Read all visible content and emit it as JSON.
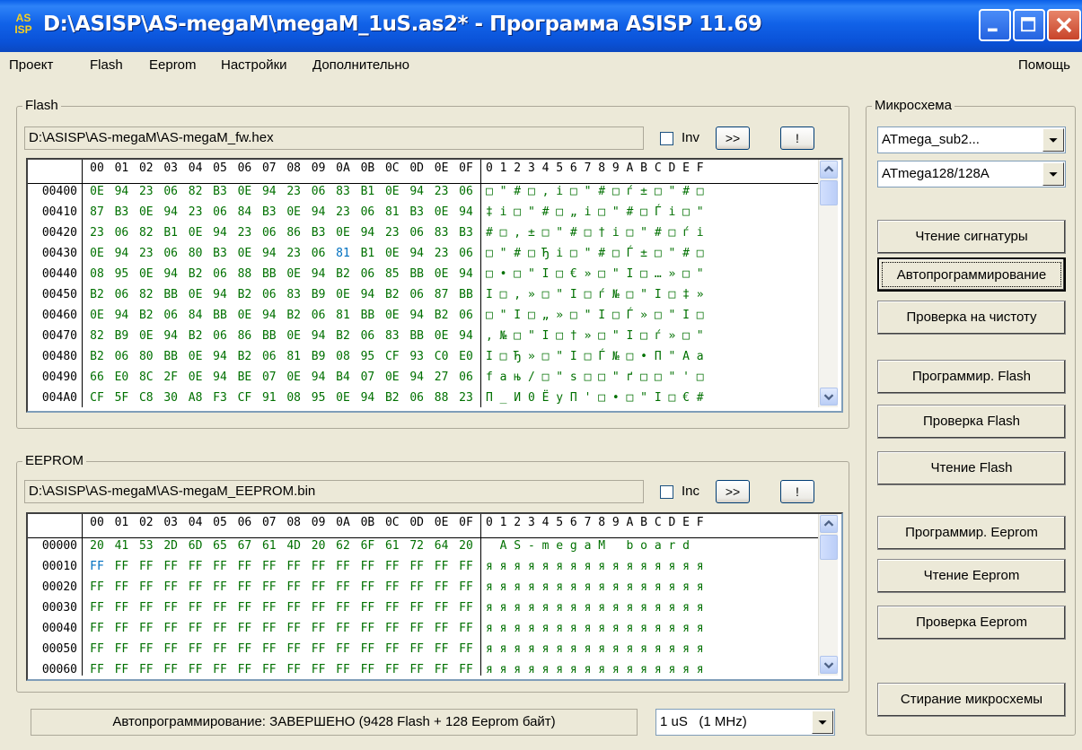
{
  "window": {
    "title": "D:\\ASISP\\AS-megaM\\megaM_1uS.as2* - Программа ASISP 11.69",
    "icon_top": "AS",
    "icon_bottom": "ISP"
  },
  "menu": {
    "items": [
      "Проект",
      "Flash",
      "Eeprom",
      "Настройки",
      "Дополнительно"
    ],
    "help": "Помощь"
  },
  "flash": {
    "title": "Flash",
    "path": "D:\\ASISP\\AS-megaM\\AS-megaM_fw.hex",
    "checkbox_label": "Inv",
    "btn_next": ">>",
    "btn_excl": "!",
    "header": [
      "00",
      "01",
      "02",
      "03",
      "04",
      "05",
      "06",
      "07",
      "08",
      "09",
      "0A",
      "0B",
      "0C",
      "0D",
      "0E",
      "0F"
    ],
    "ascii_header": "0 1 2 3 4 5 6 7 8 9 A B C D E F",
    "rows": [
      {
        "addr": "00400",
        "bytes": [
          "0E",
          "94",
          "23",
          "06",
          "82",
          "B3",
          "0E",
          "94",
          "23",
          "06",
          "83",
          "B1",
          "0E",
          "94",
          "23",
          "06"
        ],
        "ascii": "□ \" # □ , i □ \" # □ ѓ ± □ \" # □"
      },
      {
        "addr": "00410",
        "bytes": [
          "87",
          "B3",
          "0E",
          "94",
          "23",
          "06",
          "84",
          "B3",
          "0E",
          "94",
          "23",
          "06",
          "81",
          "B3",
          "0E",
          "94"
        ],
        "ascii": "‡ i □ \" # □ „ i □ \" # □ Ѓ i □ \""
      },
      {
        "addr": "00420",
        "bytes": [
          "23",
          "06",
          "82",
          "B1",
          "0E",
          "94",
          "23",
          "06",
          "86",
          "B3",
          "0E",
          "94",
          "23",
          "06",
          "83",
          "B3"
        ],
        "ascii": "# □ , ± □ \" # □ † i □ \" # □ ѓ i"
      },
      {
        "addr": "00430",
        "bytes": [
          "0E",
          "94",
          "23",
          "06",
          "80",
          "B3",
          "0E",
          "94",
          "23",
          "06",
          "81",
          "B1",
          "0E",
          "94",
          "23",
          "06"
        ],
        "ascii": "□ \" # □ Ђ i □ \" # □ Ѓ ± □ \" # □"
      },
      {
        "addr": "00440",
        "bytes": [
          "08",
          "95",
          "0E",
          "94",
          "B2",
          "06",
          "88",
          "BB",
          "0E",
          "94",
          "B2",
          "06",
          "85",
          "BB",
          "0E",
          "94"
        ],
        "ascii": "□ • □ \" I □ € » □ \" I □ … » □ \""
      },
      {
        "addr": "00450",
        "bytes": [
          "B2",
          "06",
          "82",
          "BB",
          "0E",
          "94",
          "B2",
          "06",
          "83",
          "B9",
          "0E",
          "94",
          "B2",
          "06",
          "87",
          "BB"
        ],
        "ascii": "I □ , » □ \" I □ ѓ № □ \" I □ ‡ »"
      },
      {
        "addr": "00460",
        "bytes": [
          "0E",
          "94",
          "B2",
          "06",
          "84",
          "BB",
          "0E",
          "94",
          "B2",
          "06",
          "81",
          "BB",
          "0E",
          "94",
          "B2",
          "06"
        ],
        "ascii": "□ \" I □ „ » □ \" I □ Ѓ » □ \" I □"
      },
      {
        "addr": "00470",
        "bytes": [
          "82",
          "B9",
          "0E",
          "94",
          "B2",
          "06",
          "86",
          "BB",
          "0E",
          "94",
          "B2",
          "06",
          "83",
          "BB",
          "0E",
          "94"
        ],
        "ascii": ", № □ \" I □ † » □ \" I □ ѓ » □ \""
      },
      {
        "addr": "00480",
        "bytes": [
          "B2",
          "06",
          "80",
          "BB",
          "0E",
          "94",
          "B2",
          "06",
          "81",
          "B9",
          "08",
          "95",
          "CF",
          "93",
          "C0",
          "E0"
        ],
        "ascii": "I □ Ђ » □ \" I □ Ѓ № □ • П \" А а"
      },
      {
        "addr": "00490",
        "bytes": [
          "66",
          "E0",
          "8C",
          "2F",
          "0E",
          "94",
          "BE",
          "07",
          "0E",
          "94",
          "B4",
          "07",
          "0E",
          "94",
          "27",
          "06"
        ],
        "ascii": "f a њ / □ \" s □ □ \" ґ □ □ \" ' □"
      },
      {
        "addr": "004A0",
        "bytes": [
          "CF",
          "5F",
          "C8",
          "30",
          "A8",
          "F3",
          "CF",
          "91",
          "08",
          "95",
          "0E",
          "94",
          "B2",
          "06",
          "88",
          "23"
        ],
        "ascii": "П _ И 0 Ё у П ' □ • □ \" I □ € #"
      }
    ]
  },
  "eeprom": {
    "title": "EEPROM",
    "path": "D:\\ASISP\\AS-megaM\\AS-megaM_EEPROM.bin",
    "checkbox_label": "Inc",
    "btn_next": ">>",
    "btn_excl": "!",
    "header": [
      "00",
      "01",
      "02",
      "03",
      "04",
      "05",
      "06",
      "07",
      "08",
      "09",
      "0A",
      "0B",
      "0C",
      "0D",
      "0E",
      "0F"
    ],
    "ascii_header": "0 1 2 3 4 5 6 7 8 9 A B C D E F",
    "rows": [
      {
        "addr": "00000",
        "bytes": [
          "20",
          "41",
          "53",
          "2D",
          "6D",
          "65",
          "67",
          "61",
          "4D",
          "20",
          "62",
          "6F",
          "61",
          "72",
          "64",
          "20"
        ],
        "ascii": "  A S - m e g a M   b o a r d  "
      },
      {
        "addr": "00010",
        "bytes": [
          "FF",
          "FF",
          "FF",
          "FF",
          "FF",
          "FF",
          "FF",
          "FF",
          "FF",
          "FF",
          "FF",
          "FF",
          "FF",
          "FF",
          "FF",
          "FF"
        ],
        "ascii": "я я я я я я я я я я я я я я я я"
      },
      {
        "addr": "00020",
        "bytes": [
          "FF",
          "FF",
          "FF",
          "FF",
          "FF",
          "FF",
          "FF",
          "FF",
          "FF",
          "FF",
          "FF",
          "FF",
          "FF",
          "FF",
          "FF",
          "FF"
        ],
        "ascii": "я я я я я я я я я я я я я я я я"
      },
      {
        "addr": "00030",
        "bytes": [
          "FF",
          "FF",
          "FF",
          "FF",
          "FF",
          "FF",
          "FF",
          "FF",
          "FF",
          "FF",
          "FF",
          "FF",
          "FF",
          "FF",
          "FF",
          "FF"
        ],
        "ascii": "я я я я я я я я я я я я я я я я"
      },
      {
        "addr": "00040",
        "bytes": [
          "FF",
          "FF",
          "FF",
          "FF",
          "FF",
          "FF",
          "FF",
          "FF",
          "FF",
          "FF",
          "FF",
          "FF",
          "FF",
          "FF",
          "FF",
          "FF"
        ],
        "ascii": "я я я я я я я я я я я я я я я я"
      },
      {
        "addr": "00050",
        "bytes": [
          "FF",
          "FF",
          "FF",
          "FF",
          "FF",
          "FF",
          "FF",
          "FF",
          "FF",
          "FF",
          "FF",
          "FF",
          "FF",
          "FF",
          "FF",
          "FF"
        ],
        "ascii": "я я я я я я я я я я я я я я я я"
      },
      {
        "addr": "00060",
        "bytes": [
          "FF",
          "FF",
          "FF",
          "FF",
          "FF",
          "FF",
          "FF",
          "FF",
          "FF",
          "FF",
          "FF",
          "FF",
          "FF",
          "FF",
          "FF",
          "FF"
        ],
        "ascii": "я я я я я я я я я я я я я я я я"
      }
    ]
  },
  "chip": {
    "title": "Микросхема",
    "family": "ATmega_sub2...",
    "model": "ATmega128/128A"
  },
  "buttons": {
    "read_signature": "Чтение сигнатуры",
    "autoprogram": "Автопрограммирование",
    "blank_check": "Проверка на чистоту",
    "program_flash": "Программир. Flash",
    "verify_flash": "Проверка Flash",
    "read_flash": "Чтение Flash",
    "program_eeprom": "Программир. Eeprom",
    "read_eeprom": "Чтение Eeprom",
    "verify_eeprom": "Проверка Eeprom",
    "erase_chip": "Стирание микросхемы"
  },
  "status": {
    "text": "Автопрограммирование: ЗАВЕРШЕНО (9428 Flash + 128 Eeprom байт)",
    "speed": "1 uS   (1 MHz)"
  },
  "colors": {
    "hex_data": "#007000",
    "hex_highlight": "#0070C0",
    "title_bar": "#0A52D8",
    "face": "#ECE9D8"
  }
}
